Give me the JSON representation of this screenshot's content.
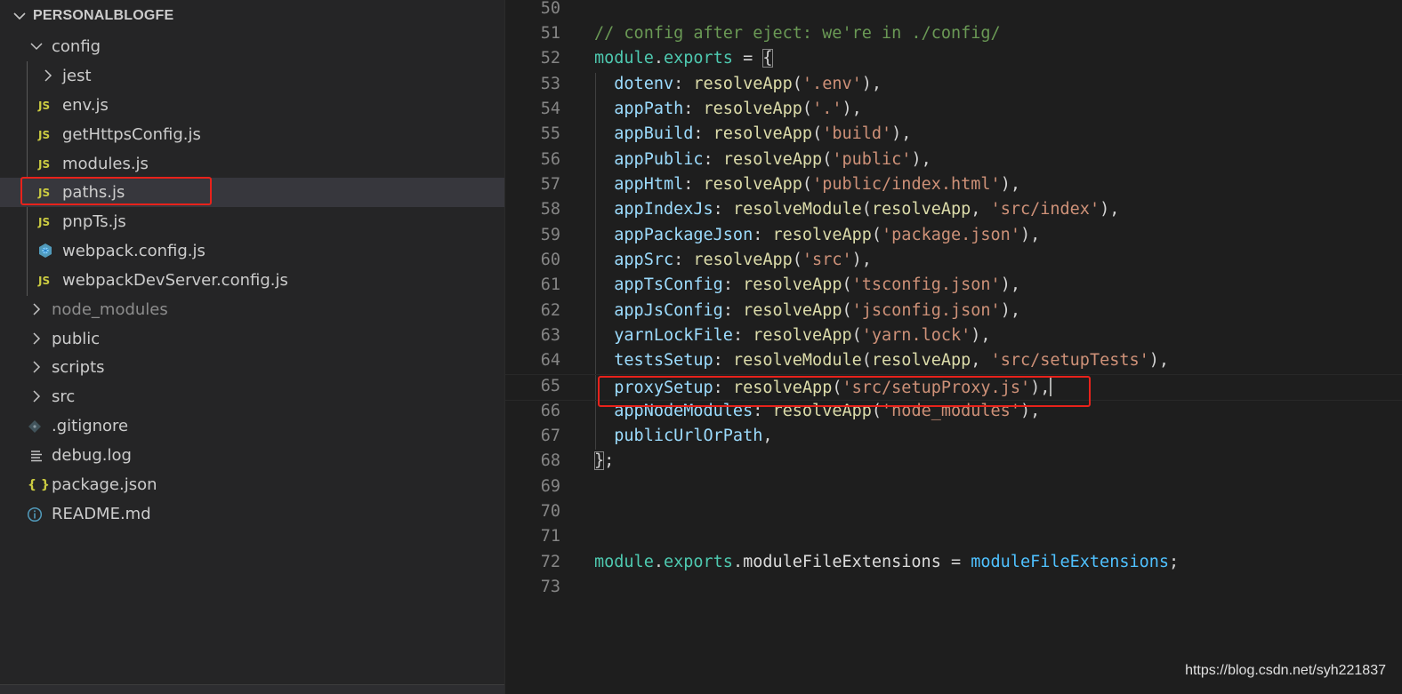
{
  "explorer": {
    "section_title": "PERSONALBLOGFE",
    "config_folder": "config",
    "config_children": {
      "jest": "jest",
      "env": "env.js",
      "getHttpsConfig": "getHttpsConfig.js",
      "modules": "modules.js",
      "paths": "paths.js",
      "pnpTs": "pnpTs.js",
      "webpack": "webpack.config.js",
      "webpackDevServer": "webpackDevServer.config.js"
    },
    "root_items": {
      "node_modules": "node_modules",
      "public": "public",
      "scripts": "scripts",
      "src": "src",
      "gitignore": ".gitignore",
      "debug": "debug.log",
      "package": "package.json",
      "readme": "README.md"
    },
    "icon_glyphs": {
      "js": "JS",
      "json": "{ }"
    },
    "selected_file": "paths.js"
  },
  "editor": {
    "current_line": 65,
    "lines": [
      {
        "n": "50"
      },
      {
        "n": "51",
        "comment": "// config after eject: we're in ./config/"
      },
      {
        "n": "52",
        "a": "module",
        "b": ".",
        "c": "exports",
        "d": " = ",
        "e": "{"
      },
      {
        "n": "53",
        "p": "dotenv",
        "s": ": ",
        "f": "resolveApp",
        "o": "(",
        "str": "'.env'",
        "cl": "),"
      },
      {
        "n": "54",
        "p": "appPath",
        "s": ": ",
        "f": "resolveApp",
        "o": "(",
        "str": "'.'",
        "cl": "),"
      },
      {
        "n": "55",
        "p": "appBuild",
        "s": ": ",
        "f": "resolveApp",
        "o": "(",
        "str": "'build'",
        "cl": "),"
      },
      {
        "n": "56",
        "p": "appPublic",
        "s": ": ",
        "f": "resolveApp",
        "o": "(",
        "str": "'public'",
        "cl": "),"
      },
      {
        "n": "57",
        "p": "appHtml",
        "s": ": ",
        "f": "resolveApp",
        "o": "(",
        "str": "'public/index.html'",
        "cl": "),"
      },
      {
        "n": "58",
        "p": "appIndexJs",
        "s": ": ",
        "f": "resolveModule",
        "o": "(",
        "f2": "resolveApp",
        "sep": ", ",
        "str": "'src/index'",
        "cl": "),"
      },
      {
        "n": "59",
        "p": "appPackageJson",
        "s": ": ",
        "f": "resolveApp",
        "o": "(",
        "str": "'package.json'",
        "cl": "),"
      },
      {
        "n": "60",
        "p": "appSrc",
        "s": ": ",
        "f": "resolveApp",
        "o": "(",
        "str": "'src'",
        "cl": "),"
      },
      {
        "n": "61",
        "p": "appTsConfig",
        "s": ": ",
        "f": "resolveApp",
        "o": "(",
        "str": "'tsconfig.json'",
        "cl": "),"
      },
      {
        "n": "62",
        "p": "appJsConfig",
        "s": ": ",
        "f": "resolveApp",
        "o": "(",
        "str": "'jsconfig.json'",
        "cl": "),"
      },
      {
        "n": "63",
        "p": "yarnLockFile",
        "s": ": ",
        "f": "resolveApp",
        "o": "(",
        "str": "'yarn.lock'",
        "cl": "),"
      },
      {
        "n": "64",
        "p": "testsSetup",
        "s": ": ",
        "f": "resolveModule",
        "o": "(",
        "f2": "resolveApp",
        "sep": ", ",
        "str": "'src/setupTests'",
        "cl": "),"
      },
      {
        "n": "65",
        "p": "proxySetup",
        "s": ": ",
        "f": "resolveApp",
        "o": "(",
        "str": "'src/setupProxy.js'",
        "cl": "),"
      },
      {
        "n": "66",
        "p": "appNodeModules",
        "s": ": ",
        "f": "resolveApp",
        "o": "(",
        "str": "'node_modules'",
        "cl": "),"
      },
      {
        "n": "67",
        "p": "publicUrlOrPath",
        "s": ","
      },
      {
        "n": "68",
        "e": "}",
        "t": ";"
      },
      {
        "n": "69"
      },
      {
        "n": "70"
      },
      {
        "n": "71"
      },
      {
        "n": "72",
        "a": "module",
        "b": ".",
        "c": "exports",
        "d": ".",
        "c2": "moduleFileExtensions",
        "d2": " = ",
        "k": "moduleFileExtensions",
        "t": ";"
      },
      {
        "n": "73"
      }
    ]
  },
  "watermark": "https://blog.csdn.net/syh221837",
  "colors": {
    "highlight_box": "#e8221b",
    "sidebar_bg": "#252526",
    "editor_bg": "#1e1e1e",
    "selected_row_bg": "#37373d",
    "js_icon": "#cbcb41"
  }
}
